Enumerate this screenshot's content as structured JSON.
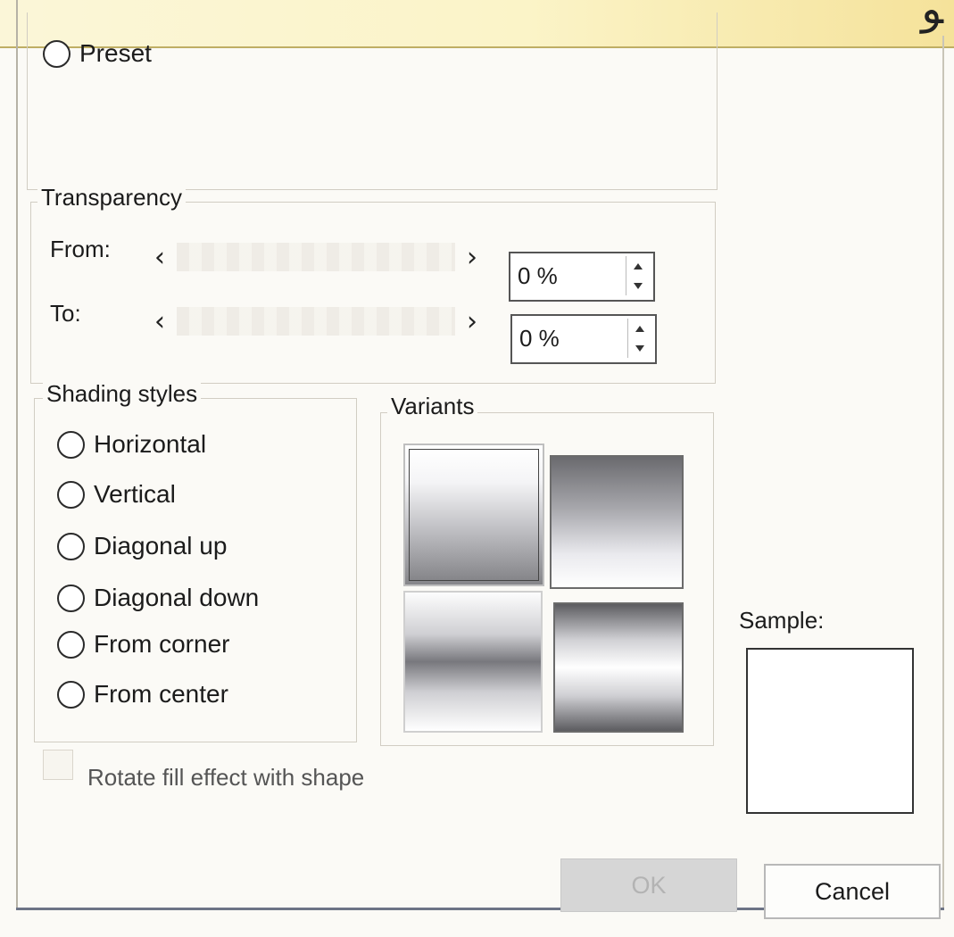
{
  "top": {
    "glyph": "ﻮ"
  },
  "preset": {
    "label": "Preset"
  },
  "transparency": {
    "title": "Transparency",
    "from_label": "From:",
    "to_label": "To:",
    "from_value": "0 %",
    "to_value": "0 %",
    "arrow_left": "‹",
    "arrow_right": "›"
  },
  "shading_styles": {
    "title": "Shading styles",
    "options": [
      "Horizontal",
      "Vertical",
      "Diagonal up",
      "Diagonal down",
      "From corner",
      "From center"
    ]
  },
  "variants": {
    "title": "Variants"
  },
  "rotate_checkbox": {
    "label": "Rotate fill effect with shape",
    "checked": false
  },
  "sample": {
    "label": "Sample:"
  },
  "buttons": {
    "ok": "OK",
    "cancel": "Cancel",
    "ok_enabled": false
  },
  "colors": {
    "accent_band": "#fbf4c8",
    "frame": "#6d7486"
  }
}
